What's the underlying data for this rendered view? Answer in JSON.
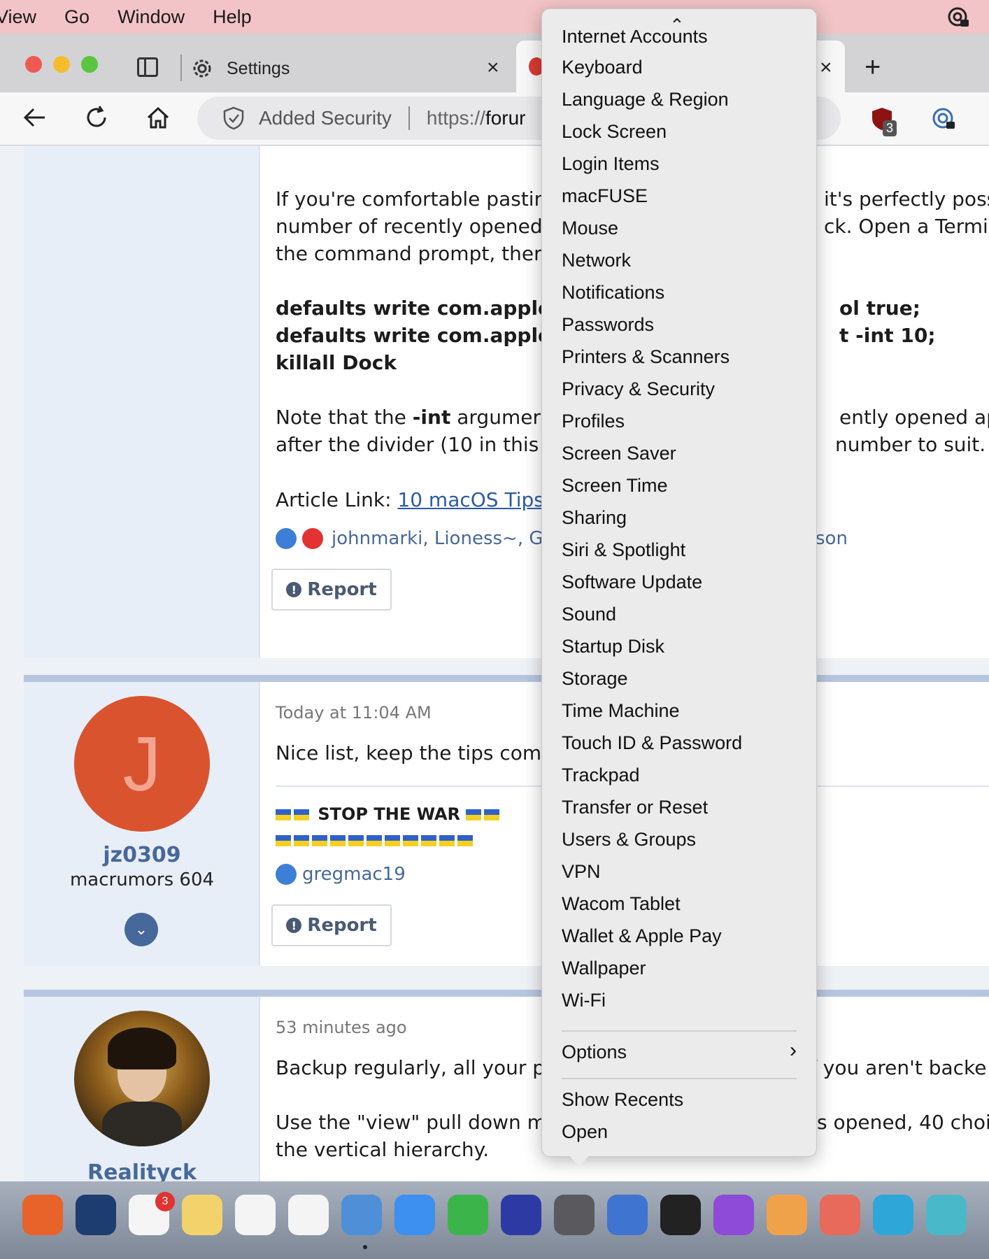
{
  "menubar": {
    "items": [
      "View",
      "Go",
      "Window",
      "Help"
    ]
  },
  "browser": {
    "tab_settings_label": "Settings",
    "tab_close": "×",
    "new_tab": "+",
    "url_security": "Added Security",
    "url_prefix": "https://",
    "url_host_visible": "forur",
    "ext_badge": "3"
  },
  "posts": [
    {
      "lines": [
        "If you're comfortable pastin",
        "number of recently opened",
        "the command prompt, ther"
      ],
      "right_lines": [
        "it's perfectly poss",
        "ck. Open a Termin"
      ],
      "code_lines": [
        "defaults write com.apple",
        "defaults write com.apple",
        "killall Dock"
      ],
      "code_right": [
        "ol true;",
        "t -int 10;"
      ],
      "note_start": "Note that the ",
      "note_bold": "-int",
      "note_rest": " argumer",
      "note_line2": "after the divider (10 in this",
      "note_right1": "ently opened apps",
      "note_right2": "number to suit.",
      "article_label": "Article Link: ",
      "article_link": "10 macOS Tips",
      "reactions": "johnmarki, Lioness~, G",
      "reactions_right": "son",
      "report": "Report"
    },
    {
      "avatar_letter": "J",
      "username": "jz0309",
      "user_title": "macrumors 604",
      "meta": "Today at 11:04 AM",
      "text": "Nice list, keep the tips com",
      "signature": "STOP THE WAR",
      "reactions": "gregmac19",
      "report": "Report"
    },
    {
      "username": "Realityck",
      "meta": "53 minutes ago",
      "text": "Backup regularly, all your p",
      "text_right": "f you aren't backe",
      "line2": "Use the \"view\" pull down m",
      "line2_right": "s opened, 40 choi",
      "line3": "the vertical hierarchy."
    }
  ],
  "menu": {
    "scroll_up": "⌃",
    "partial_item": "Internet Accounts",
    "items": [
      "Keyboard",
      "Language & Region",
      "Lock Screen",
      "Login Items",
      "macFUSE",
      "Mouse",
      "Network",
      "Notifications",
      "Passwords",
      "Printers & Scanners",
      "Privacy & Security",
      "Profiles",
      "Screen Saver",
      "Screen Time",
      "Sharing",
      "Siri & Spotlight",
      "Software Update",
      "Sound",
      "Startup Disk",
      "Storage",
      "Time Machine",
      "Touch ID & Password",
      "Trackpad",
      "Transfer or Reset",
      "Users & Groups",
      "VPN",
      "Wacom Tablet",
      "Wallet & Apple Pay",
      "Wallpaper",
      "Wi-Fi"
    ],
    "options": "Options",
    "options_chevron": "›",
    "show_recents": "Show Recents",
    "open": "Open"
  },
  "dock": {
    "reminders_badge": "3",
    "icons": [
      "firefox-icon",
      "1password-icon",
      "reminders-icon",
      "notes-icon",
      "photos-icon",
      "freeform-icon",
      "mailspring-icon",
      "mail-icon",
      "numbers-icon",
      "bbedit-icon",
      "system-settings-icon",
      "preview-icon",
      "terminal-icon",
      "feedback-icon",
      "pages-icon",
      "keyboard-icon",
      "keyboard-viewer-icon",
      "clipboard-icon"
    ]
  }
}
